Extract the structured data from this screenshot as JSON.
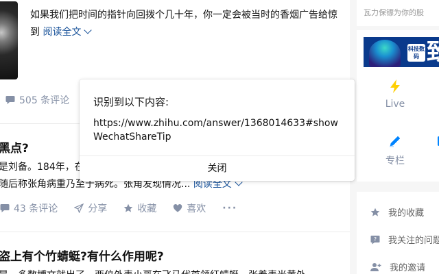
{
  "feed": {
    "item1": {
      "excerpt": "如果我们把时间的指针向回拨个几十年，你一定会被当时的香烟广告给惊到",
      "read_more": "阅读全文",
      "comments": "505 条评论"
    },
    "item2": {
      "title": "黑点?",
      "line1": "是刘备。184年，在",
      "line2": "随后称张角病重乃至于病死。张角发现情况...",
      "read_more": "阅读全文",
      "actions": {
        "comments": "43 条评论",
        "share": "分享",
        "favorite": "收藏",
        "like": "喜欢",
        "more": "···"
      }
    },
    "item3": {
      "title": "盗上有个竹蜻蜓?有什么作用呢?",
      "line1": "是，多数博文就出了，西位外表小哥在飞马代首领红蜻蜓，张着表光黄外"
    }
  },
  "sidebar": {
    "top_text": "瓦力保镖为你的股",
    "banner": {
      "tag": "科技数码",
      "big_char": "致"
    },
    "quick": {
      "live": "Live",
      "column": "专栏"
    },
    "links": {
      "favorites": "我的收藏",
      "following_questions": "我关注的问题",
      "invitations": "我的邀请"
    }
  },
  "popup": {
    "title": "识别到以下内容:",
    "url": "https://www.zhihu.com/answer/1368014633#showWechatShareTip",
    "close_label": "关闭"
  },
  "colors": {
    "link_blue": "#175199",
    "muted": "#8590a6",
    "accent_blue": "#0084ff",
    "live_yellow": "#ffcf00"
  }
}
